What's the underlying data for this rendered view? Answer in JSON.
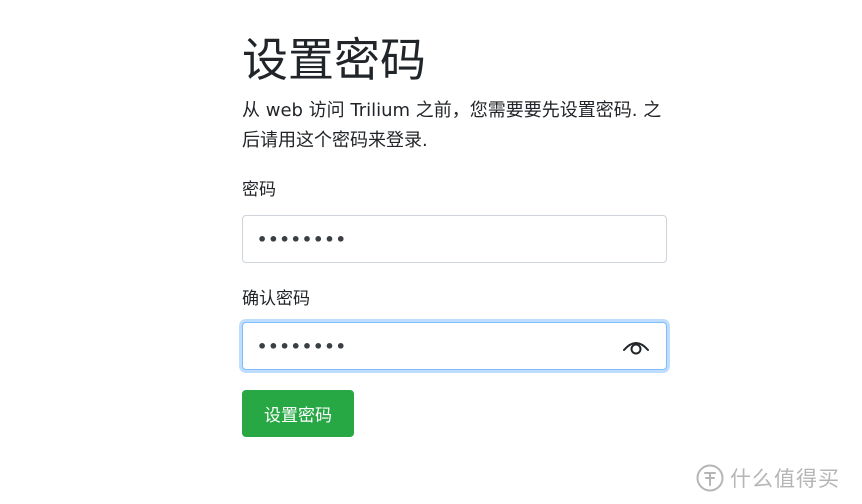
{
  "page": {
    "title": "设置密码",
    "intro": "从 web 访问 Trilium 之前，您需要要先设置密码. 之后请用这个密码来登录."
  },
  "form": {
    "password_label": "密码",
    "password_value": "••••••••",
    "confirm_label": "确认密码",
    "confirm_value": "••••••••",
    "submit_label": "设置密码"
  },
  "watermark": {
    "text": "什么值得买"
  },
  "icons": {
    "toggle_visibility": "eye-icon",
    "watermark_logo": "smzdm-logo-icon"
  },
  "colors": {
    "primary_button": "#28a745",
    "focus_border": "#80bdff",
    "input_border": "#ced4da"
  }
}
